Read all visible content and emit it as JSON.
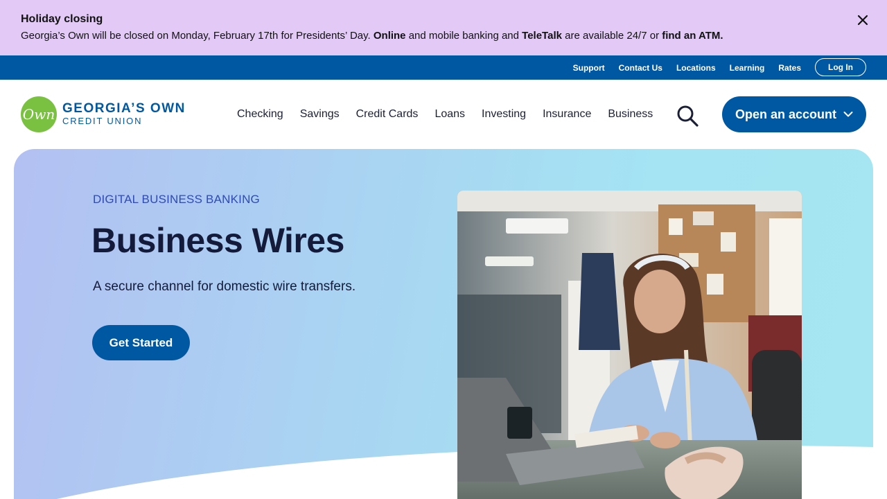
{
  "alert": {
    "title": "Holiday closing",
    "message_part1": "Georgia’s Own will be closed on Monday, February 17th for Presidents’ Day. ",
    "online": "Online",
    "message_part2": " and mobile banking and ",
    "teletalk": "TeleTalk",
    "message_part3": " are available 24/7 or ",
    "atm_link": "find an ATM.",
    "close_icon": "close-icon"
  },
  "utility": {
    "links": [
      "Support",
      "Contact Us",
      "Locations",
      "Learning",
      "Rates"
    ],
    "login": "Log In"
  },
  "logo": {
    "badge": "Own",
    "line1": "GEORGIA’S OWN",
    "line2": "CREDIT UNION"
  },
  "nav": {
    "items": [
      "Checking",
      "Savings",
      "Credit Cards",
      "Loans",
      "Investing",
      "Insurance",
      "Business"
    ],
    "search_icon": "search-icon",
    "open_account": "Open an account"
  },
  "hero": {
    "eyebrow": "DIGITAL BUSINESS BANKING",
    "title": "Business Wires",
    "subtitle": "A secure channel for domestic wire transfers.",
    "cta": "Get Started"
  },
  "colors": {
    "alert_bg": "#e2c9f6",
    "brand_blue": "#0058a3",
    "logo_green": "#7ac142",
    "eyebrow": "#2f4bb3"
  }
}
